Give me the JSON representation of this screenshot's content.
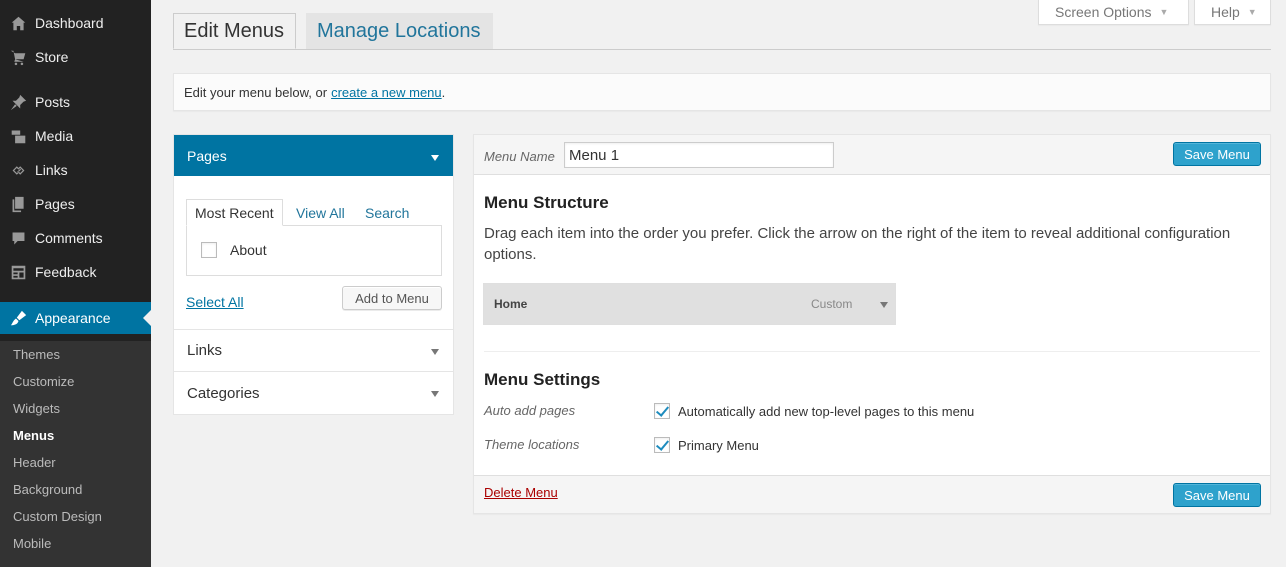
{
  "sidebar": {
    "items": [
      {
        "label": "Dashboard",
        "icon": "dashboard-icon"
      },
      {
        "label": "Store",
        "icon": "cart-icon"
      },
      {
        "label": "Posts",
        "icon": "pin-icon"
      },
      {
        "label": "Media",
        "icon": "media-icon"
      },
      {
        "label": "Links",
        "icon": "link-icon"
      },
      {
        "label": "Pages",
        "icon": "pages-icon"
      },
      {
        "label": "Comments",
        "icon": "comment-icon"
      },
      {
        "label": "Feedback",
        "icon": "feedback-icon"
      },
      {
        "label": "Appearance",
        "icon": "brush-icon"
      }
    ],
    "submenu": [
      "Themes",
      "Customize",
      "Widgets",
      "Menus",
      "Header",
      "Background",
      "Custom Design",
      "Mobile"
    ]
  },
  "top": {
    "screen_options": "Screen Options",
    "help": "Help"
  },
  "tabs": {
    "edit": "Edit Menus",
    "manage": "Manage Locations"
  },
  "notice": {
    "text": "Edit your menu below, or",
    "link": "create a new menu",
    "suffix": "."
  },
  "accordion": {
    "pages_title": "Pages",
    "tab_most_recent": "Most Recent",
    "tab_view_all": "View All",
    "tab_search": "Search",
    "page_items": [
      "About"
    ],
    "select_all": "Select All",
    "add_to_menu": "Add to Menu",
    "links_title": "Links",
    "categories_title": "Categories"
  },
  "menu": {
    "name_label": "Menu Name",
    "name_value": "Menu 1",
    "save_label": "Save Menu",
    "structure_title": "Menu Structure",
    "structure_desc": "Drag each item into the order you prefer. Click the arrow on the right of the item to reveal additional configuration options.",
    "item_title": "Home",
    "item_type": "Custom",
    "settings_title": "Menu Settings",
    "auto_add_label": "Auto add pages",
    "auto_add_option": "Automatically add new top-level pages to this menu",
    "auto_add_checked": true,
    "theme_locations_label": "Theme locations",
    "primary_menu_option": "Primary Menu",
    "primary_menu_checked": true,
    "delete_label": "Delete Menu"
  },
  "colors": {
    "accent": "#0074a2",
    "button": "#2ea2cc",
    "sidebar_bg": "#222222",
    "delete": "#aa0000"
  }
}
